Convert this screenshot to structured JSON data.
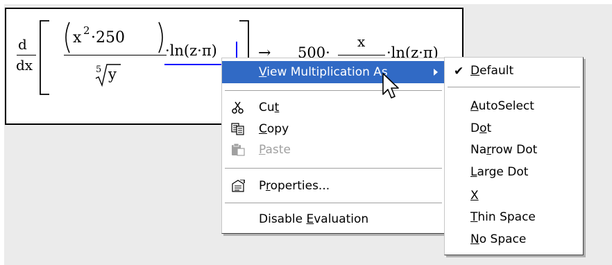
{
  "expression": {
    "lhs": {
      "d_top": "d",
      "d_bottom": "dx",
      "numerator": "(x²·250)",
      "num_x": "x",
      "num_exp": "2",
      "num_mult": "·250",
      "root_index": "5",
      "root_radicand": "y",
      "ln_term": "·ln(z·π)"
    },
    "arrow": "→",
    "rhs": {
      "coef": "500·",
      "frac_top": "x",
      "ln_term": "·ln(z·π)"
    }
  },
  "context_menu": {
    "items": [
      {
        "label": "View Multiplication As",
        "selected": true,
        "has_submenu": true
      },
      {
        "label": "Cut",
        "icon": "scissors-icon"
      },
      {
        "label": "Copy",
        "icon": "copy-icon"
      },
      {
        "label": "Paste",
        "icon": "paste-icon",
        "disabled": true
      },
      {
        "label": "Properties...",
        "icon": "properties-icon"
      },
      {
        "label": "Disable Evaluation"
      }
    ]
  },
  "submenu": {
    "items": [
      {
        "label": "Default",
        "checked": true
      },
      {
        "label": "AutoSelect"
      },
      {
        "label": "Dot"
      },
      {
        "label": "Narrow Dot"
      },
      {
        "label": "Large Dot"
      },
      {
        "label": "X"
      },
      {
        "label": "Thin Space"
      },
      {
        "label": "No Space"
      }
    ]
  },
  "colors": {
    "menu_highlight": "#316ac5",
    "underline_blue": "#0000ff",
    "worksheet_bg": "#ebebeb"
  }
}
